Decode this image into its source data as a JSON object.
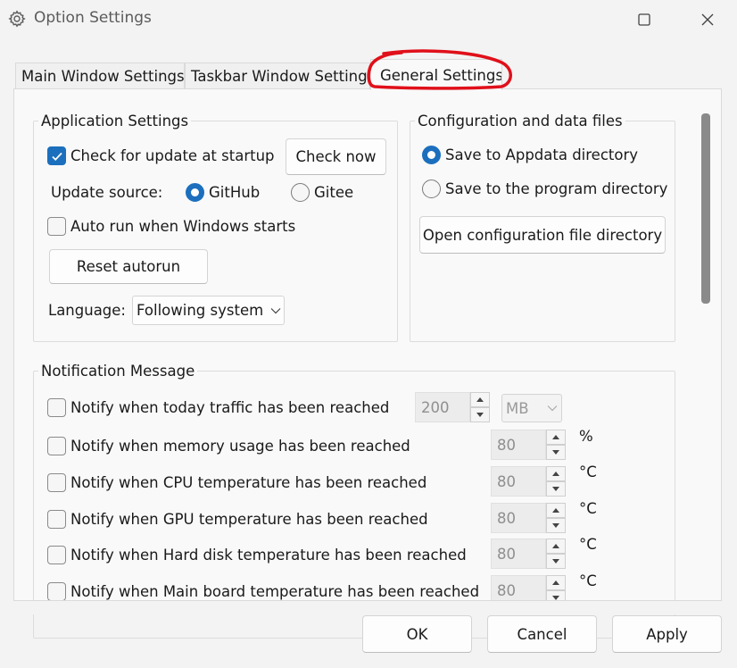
{
  "window": {
    "title": "Option Settings",
    "icons": {
      "app": "gear-icon",
      "maximize": "maximize-icon",
      "close": "close-icon"
    }
  },
  "tabs": [
    {
      "label": "Main Window Settings",
      "active": false
    },
    {
      "label": "Taskbar Window Settings",
      "active": false
    },
    {
      "label": "General Settings",
      "active": true
    }
  ],
  "app_settings": {
    "title": "Application Settings",
    "check_update_label": "Check for update at startup",
    "check_update_checked": true,
    "check_now_label": "Check now",
    "update_source_label": "Update source:",
    "source_github": "GitHub",
    "source_gitee": "Gitee",
    "selected_source": "GitHub",
    "autorun_label": "Auto run when Windows starts",
    "autorun_checked": false,
    "reset_autorun_label": "Reset autorun",
    "language_label": "Language:",
    "language_value": "Following system"
  },
  "config_files": {
    "title": "Configuration and data files",
    "save_appdata_label": "Save to Appdata directory",
    "save_program_label": "Save to the program directory",
    "selected": "appdata",
    "open_dir_label": "Open configuration file directory"
  },
  "notification": {
    "title": "Notification Message",
    "items": [
      {
        "label": "Notify when today traffic has been reached",
        "value": "200",
        "unit": "MB",
        "checked": false
      },
      {
        "label": "Notify when memory usage has been reached",
        "value": "80",
        "unit": "%",
        "checked": false
      },
      {
        "label": "Notify when CPU temperature has been reached",
        "value": "80",
        "unit": "°C",
        "checked": false
      },
      {
        "label": "Notify when GPU temperature has been reached",
        "value": "80",
        "unit": "°C",
        "checked": false
      },
      {
        "label": "Notify when Hard disk temperature has been reached",
        "value": "80",
        "unit": "°C",
        "checked": false
      },
      {
        "label": "Notify when Main board temperature has been reached",
        "value": "80",
        "unit": "°C",
        "checked": false
      }
    ]
  },
  "footer": {
    "ok_label": "OK",
    "cancel_label": "Cancel",
    "apply_label": "Apply"
  },
  "colors": {
    "accent": "#1c6fbd",
    "highlight_annotation": "#e0101a"
  }
}
